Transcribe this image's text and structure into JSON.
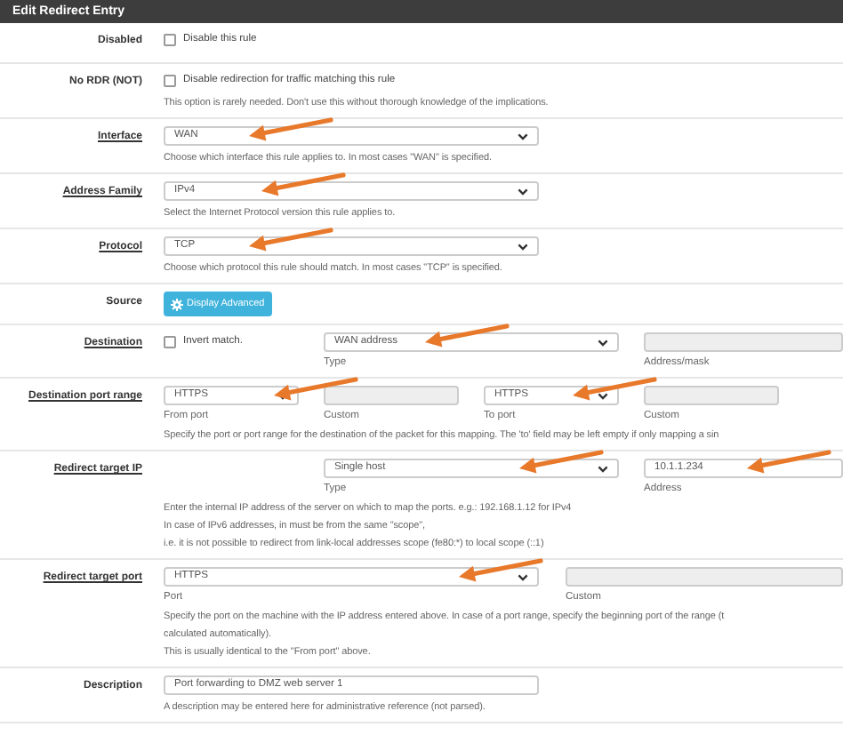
{
  "panel": {
    "title": "Edit Redirect Entry"
  },
  "rows": [
    {
      "label": "Disabled",
      "underlined": false,
      "kind": "checkbox",
      "controls": [
        {
          "kind": "checkbox",
          "label": "Disable this rule",
          "checked": false
        }
      ]
    },
    {
      "label": "No RDR (NOT)",
      "underlined": false,
      "kind": "checkbox",
      "controls": [
        {
          "kind": "checkbox",
          "label": "Disable redirection for traffic matching this rule",
          "checked": false
        }
      ],
      "help": [
        "This option is rarely needed. Don't use this without thorough knowledge of the implications."
      ]
    },
    {
      "label": "Interface",
      "underlined": true,
      "kind": "single",
      "controls": [
        {
          "kind": "select",
          "value": "WAN"
        }
      ],
      "help": [
        "Choose which interface this rule applies to. In most cases \"WAN\" is specified."
      ]
    },
    {
      "label": "Address Family",
      "underlined": true,
      "kind": "single",
      "controls": [
        {
          "kind": "select",
          "value": "IPv4"
        }
      ],
      "help": [
        "Select the Internet Protocol version this rule applies to."
      ]
    },
    {
      "label": "Protocol",
      "underlined": true,
      "kind": "single",
      "controls": [
        {
          "kind": "select",
          "value": "TCP"
        }
      ],
      "help": [
        "Choose which protocol this rule should match. In most cases \"TCP\" is specified."
      ]
    },
    {
      "label": "Source",
      "underlined": false,
      "kind": "button",
      "controls": [
        {
          "kind": "button",
          "label": "Display Advanced"
        }
      ]
    },
    {
      "label": "Destination",
      "underlined": true,
      "kind": "destination",
      "controls": [
        {
          "kind": "checkbox",
          "label": "Invert match.",
          "checked": false
        },
        {
          "kind": "select",
          "value": "WAN address",
          "caption": "Type"
        },
        {
          "kind": "input",
          "disabled": true,
          "caption": "Address/mask"
        }
      ]
    },
    {
      "label": "Destination port range",
      "underlined": true,
      "kind": "port_range",
      "controls": [
        {
          "kind": "select",
          "value": "HTTPS",
          "caption": "From port"
        },
        {
          "kind": "input",
          "disabled": true,
          "caption": "Custom"
        },
        {
          "kind": "select",
          "value": "HTTPS",
          "caption": "To port"
        },
        {
          "kind": "input",
          "disabled": true,
          "caption": "Custom"
        }
      ],
      "help": [
        "Specify the port or port range for the destination of the packet for this mapping. The 'to' field may be left empty if only mapping a sin"
      ]
    },
    {
      "label": "Redirect target IP",
      "underlined": true,
      "kind": "target_ip",
      "controls": [
        {
          "kind": "select",
          "value": "Single host",
          "caption": "Type"
        },
        {
          "kind": "input",
          "disabled": false,
          "value": "10.1.1.234",
          "caption": "Address"
        }
      ],
      "help": [
        "Enter the internal IP address of the server on which to map the ports. e.g.: 192.168.1.12 for IPv4",
        "In case of IPv6 addresses, in must be from the same \"scope\",",
        "i.e. it is not possible to redirect from link-local addresses scope (fe80:*) to local scope (::1)"
      ]
    },
    {
      "label": "Redirect target port",
      "underlined": true,
      "kind": "target_port",
      "controls": [
        {
          "kind": "select",
          "value": "HTTPS",
          "caption": "Port"
        },
        {
          "kind": "input",
          "disabled": true,
          "caption": "Custom"
        }
      ],
      "help": [
        "Specify the port on the machine with the IP address entered above. In case of a port range, specify the beginning port of the range (t",
        "calculated automatically).",
        "This is usually identical to the \"From port\" above."
      ]
    },
    {
      "label": "Description",
      "underlined": false,
      "kind": "single",
      "controls": [
        {
          "kind": "input",
          "disabled": false,
          "value": "Port forwarding to DMZ web server 1"
        }
      ],
      "help": [
        "A description may be entered here for administrative reference (not parsed)."
      ]
    }
  ]
}
